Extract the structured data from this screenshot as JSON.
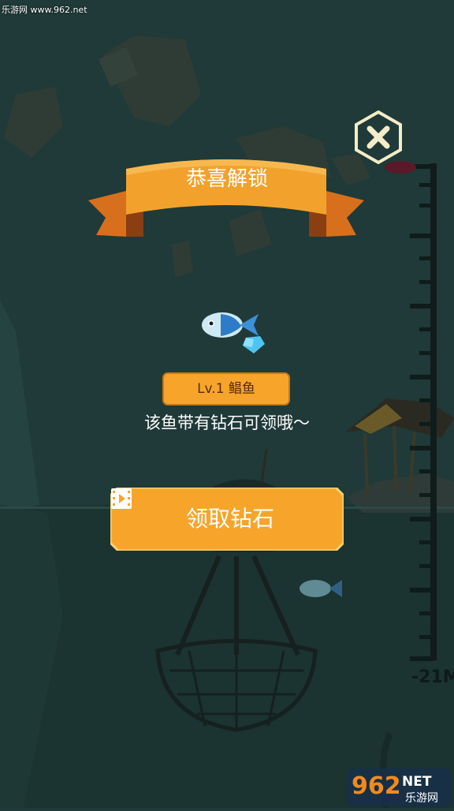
{
  "header": {
    "watermark": "乐游网 www.962.net"
  },
  "unlock_title": "恭喜解锁",
  "fish": {
    "level_label": "Lv.1 鲳鱼",
    "description": "该鱼带有钻石可领哦～"
  },
  "claim_button": {
    "label": "领取钻石",
    "icon": "video-icon"
  },
  "close_button": {
    "icon": "close-icon"
  },
  "depth": {
    "label": "-21M"
  },
  "footer_logo": {
    "number": "962",
    "suffix": "NET",
    "subtitle": "乐游网"
  },
  "colors": {
    "background": "#1f3a38",
    "ribbon": "#f2a22c",
    "ribbon_dark": "#b4561a",
    "button": "#f7a52a",
    "badge_text": "#5a2b10",
    "close_icon": "#f4ecc8"
  }
}
